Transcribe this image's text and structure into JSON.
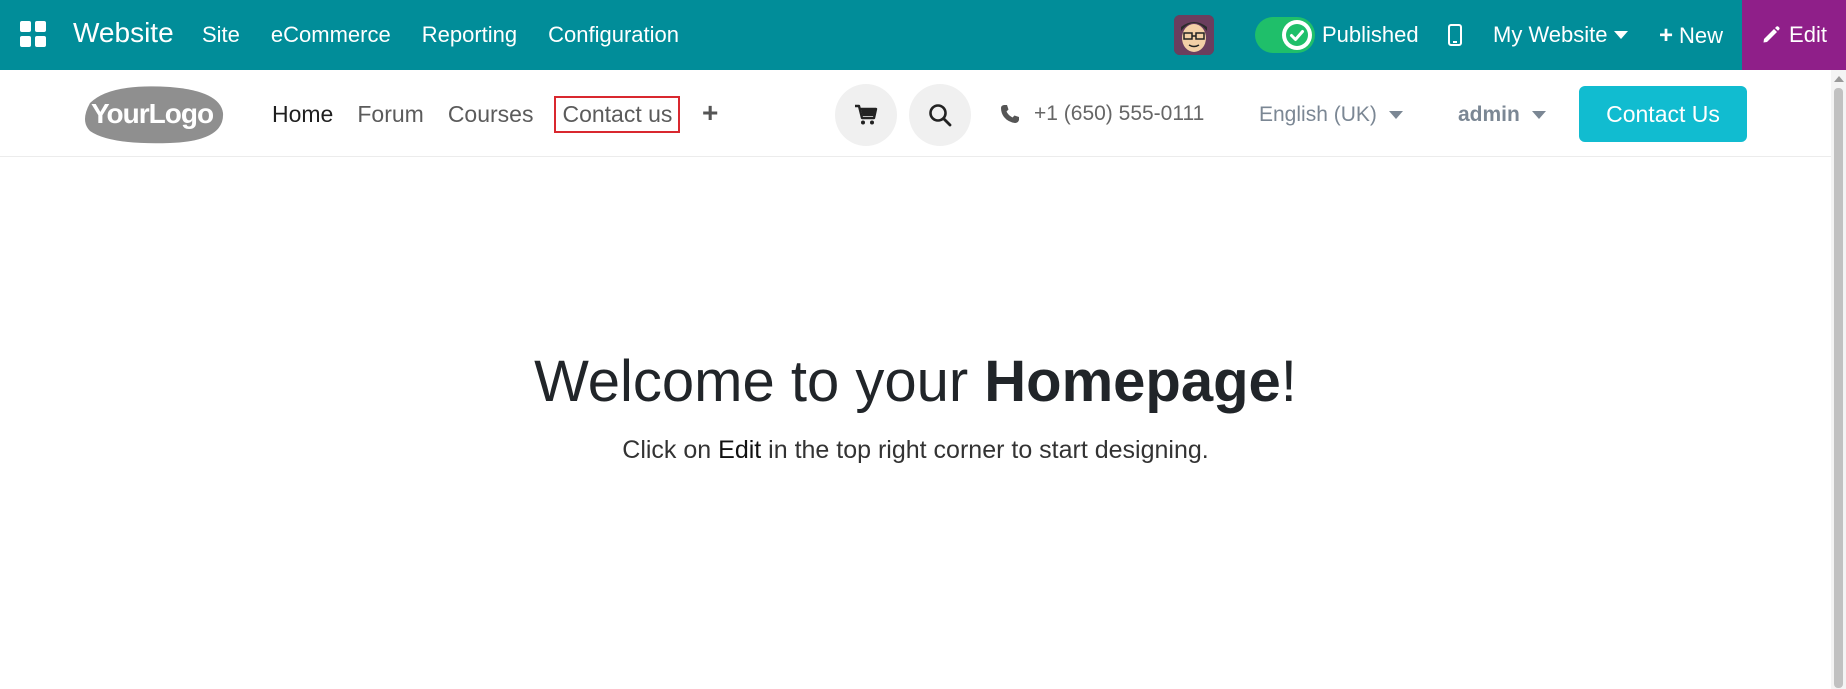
{
  "topbar": {
    "app_name": "Website",
    "menu": [
      "Site",
      "eCommerce",
      "Reporting",
      "Configuration"
    ],
    "published_label": "Published",
    "my_website_label": "My Website",
    "new_label": "New",
    "edit_label": "Edit",
    "color": "#018d99",
    "edit_color": "#8f1f89",
    "toggle_color": "#1fbf6a"
  },
  "header": {
    "logo_text": "YourLogo",
    "nav": [
      "Home",
      "Forum",
      "Courses",
      "Contact us"
    ],
    "active_nav": "Home",
    "highlighted_nav": "Contact us",
    "phone": "+1 (650) 555-0111",
    "language": "English (UK)",
    "user": "admin",
    "contact_button": "Contact Us",
    "accent_color": "#11bcd0",
    "highlight_color": "#d9282f"
  },
  "main": {
    "title_prefix": "Welcome to your ",
    "title_bold": "Homepage",
    "title_suffix": "!",
    "subtitle_prefix": "Click on ",
    "subtitle_bold": "Edit",
    "subtitle_suffix": " in the top right corner to start designing."
  }
}
